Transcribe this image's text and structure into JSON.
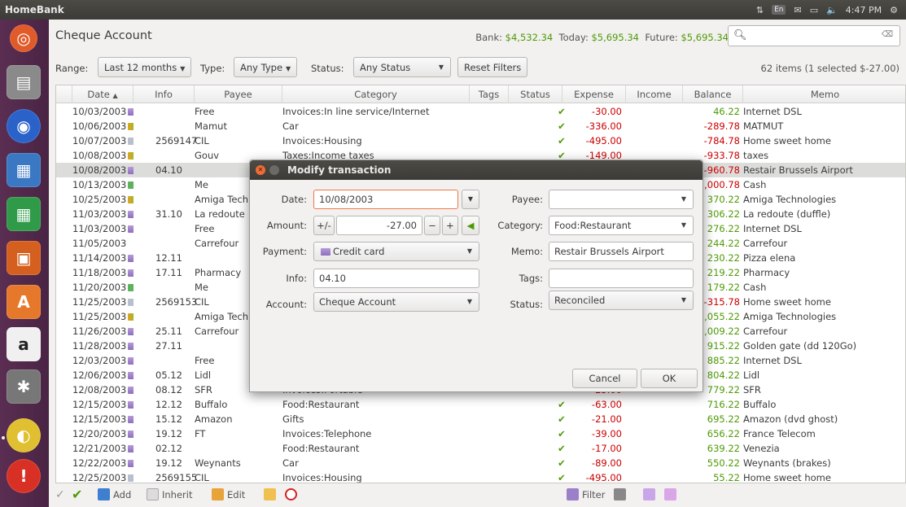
{
  "app_title": "HomeBank",
  "indicators": {
    "keyboard": "En",
    "time": "4:47 PM"
  },
  "account": {
    "title": "Cheque Account",
    "bank_label": "Bank:",
    "bank_value": "$4,532.34",
    "today_label": "Today:",
    "today_value": "$5,695.34",
    "future_label": "Future:",
    "future_value": "$5,695.34"
  },
  "filters": {
    "range_label": "Range:",
    "range_value": "Last 12 months",
    "type_label": "Type:",
    "type_value": "Any Type",
    "status_label": "Status:",
    "status_value": "Any Status",
    "reset_label": "Reset Filters",
    "items_count": "62 items (1 selected $-27.00)"
  },
  "columns": [
    "Date",
    "Info",
    "Payee",
    "Category",
    "Tags",
    "Status",
    "Expense",
    "Income",
    "Balance",
    "Memo"
  ],
  "rows": [
    {
      "date": "10/03/2003",
      "pay": "card",
      "info": "",
      "payee": "Free",
      "cat": "Invoices:In line service/Internet",
      "exp": "-30.00",
      "bal": "46.22",
      "memo": "Internet DSL"
    },
    {
      "date": "10/06/2003",
      "pay": "xfer",
      "info": "",
      "payee": "Mamut",
      "cat": "Car",
      "exp": "-336.00",
      "bal": "-289.78",
      "memo": "MATMUT"
    },
    {
      "date": "10/07/2003",
      "pay": "check",
      "info": "2569147",
      "payee": "CIL",
      "cat": "Invoices:Housing",
      "exp": "-495.00",
      "bal": "-784.78",
      "memo": "Home sweet home"
    },
    {
      "date": "10/08/2003",
      "pay": "xfer",
      "info": "",
      "payee": "Gouv",
      "cat": "Taxes:Income taxes",
      "exp": "-149.00",
      "bal": "-933.78",
      "memo": "taxes"
    },
    {
      "date": "10/08/2003",
      "pay": "card",
      "info": "04.10",
      "payee": "",
      "cat": "",
      "exp": "",
      "bal": "-960.78",
      "memo": "Restair Brussels Airport",
      "sel": true
    },
    {
      "date": "10/13/2003",
      "pay": "cash",
      "info": "",
      "payee": "Me",
      "cat": "",
      "exp": "",
      "bal": "-1,000.78",
      "memo": "Cash"
    },
    {
      "date": "10/25/2003",
      "pay": "xfer",
      "info": "",
      "payee": "Amiga Tech",
      "cat": "",
      "exp": "",
      "bal": "370.22",
      "memo": "Amiga Technologies"
    },
    {
      "date": "11/03/2003",
      "pay": "card",
      "info": "31.10",
      "payee": "La redoute",
      "cat": "",
      "exp": "",
      "bal": "306.22",
      "memo": "La redoute (duffle)"
    },
    {
      "date": "11/03/2003",
      "pay": "card",
      "info": "",
      "payee": "Free",
      "cat": "",
      "exp": "",
      "bal": "276.22",
      "memo": "Internet DSL"
    },
    {
      "date": "11/05/2003",
      "pay": "none",
      "info": "",
      "payee": "Carrefour",
      "cat": "",
      "exp": "",
      "bal": "244.22",
      "memo": "Carrefour"
    },
    {
      "date": "11/14/2003",
      "pay": "card",
      "info": "12.11",
      "payee": "",
      "cat": "",
      "exp": "",
      "bal": "230.22",
      "memo": "Pizza elena"
    },
    {
      "date": "11/18/2003",
      "pay": "card",
      "info": "17.11",
      "payee": "Pharmacy",
      "cat": "",
      "exp": "",
      "bal": "219.22",
      "memo": "Pharmacy"
    },
    {
      "date": "11/20/2003",
      "pay": "cash",
      "info": "",
      "payee": "Me",
      "cat": "",
      "exp": "",
      "bal": "179.22",
      "memo": "Cash"
    },
    {
      "date": "11/25/2003",
      "pay": "check",
      "info": "2569153",
      "payee": "CIL",
      "cat": "",
      "exp": "",
      "bal": "-315.78",
      "memo": "Home sweet home"
    },
    {
      "date": "11/25/2003",
      "pay": "xfer",
      "info": "",
      "payee": "Amiga Tech",
      "cat": "",
      "exp": "",
      "bal": "1,055.22",
      "memo": "Amiga Technologies"
    },
    {
      "date": "11/26/2003",
      "pay": "card",
      "info": "25.11",
      "payee": "Carrefour",
      "cat": "",
      "exp": "",
      "bal": "1,009.22",
      "memo": "Carrefour"
    },
    {
      "date": "11/28/2003",
      "pay": "card",
      "info": "27.11",
      "payee": "",
      "cat": "",
      "exp": "",
      "bal": "915.22",
      "memo": "Golden gate (dd 120Go)"
    },
    {
      "date": "12/03/2003",
      "pay": "card",
      "info": "",
      "payee": "Free",
      "cat": "",
      "exp": "",
      "bal": "885.22",
      "memo": "Internet DSL"
    },
    {
      "date": "12/06/2003",
      "pay": "card",
      "info": "05.12",
      "payee": "Lidl",
      "cat": "",
      "exp": "",
      "bal": "804.22",
      "memo": "Lidl"
    },
    {
      "date": "12/08/2003",
      "pay": "card",
      "info": "08.12",
      "payee": "SFR",
      "cat": "Invoices:Portable",
      "exp": "-25.00",
      "bal": "779.22",
      "memo": "SFR"
    },
    {
      "date": "12/15/2003",
      "pay": "card",
      "info": "12.12",
      "payee": "Buffalo",
      "cat": "Food:Restaurant",
      "exp": "-63.00",
      "bal": "716.22",
      "memo": "Buffalo"
    },
    {
      "date": "12/15/2003",
      "pay": "card",
      "info": "15.12",
      "payee": "Amazon",
      "cat": "Gifts",
      "exp": "-21.00",
      "bal": "695.22",
      "memo": "Amazon (dvd ghost)"
    },
    {
      "date": "12/20/2003",
      "pay": "card",
      "info": "19.12",
      "payee": "FT",
      "cat": "Invoices:Telephone",
      "exp": "-39.00",
      "bal": "656.22",
      "memo": "France Telecom"
    },
    {
      "date": "12/21/2003",
      "pay": "card",
      "info": "02.12",
      "payee": "",
      "cat": "Food:Restaurant",
      "exp": "-17.00",
      "bal": "639.22",
      "memo": "Venezia"
    },
    {
      "date": "12/22/2003",
      "pay": "card",
      "info": "19.12",
      "payee": "Weynants",
      "cat": "Car",
      "exp": "-89.00",
      "bal": "550.22",
      "memo": "Weynants (brakes)"
    },
    {
      "date": "12/25/2003",
      "pay": "check",
      "info": "2569155",
      "payee": "CIL",
      "cat": "Invoices:Housing",
      "exp": "-495.00",
      "bal": "55.22",
      "memo": "Home sweet home"
    }
  ],
  "toolbar": {
    "add": "Add",
    "inherit": "Inherit",
    "edit": "Edit",
    "filter": "Filter"
  },
  "dialog": {
    "title": "Modify transaction",
    "date_label": "Date:",
    "date_value": "10/08/2003",
    "amount_label": "Amount:",
    "amount_sign": "+/-",
    "amount_value": "-27.00",
    "minus": "−",
    "plus": "+",
    "payment_label": "Payment:",
    "payment_value": "Credit card",
    "info_label": "Info:",
    "info_value": "04.10",
    "account_label": "Account:",
    "account_value": "Cheque Account",
    "payee_label": "Payee:",
    "payee_value": "",
    "category_label": "Category:",
    "category_value": "Food:Restaurant",
    "memo_label": "Memo:",
    "memo_value": "Restair Brussels Airport",
    "tags_label": "Tags:",
    "tags_value": "",
    "status_label": "Status:",
    "status_value": "Reconciled",
    "cancel": "Cancel",
    "ok": "OK"
  },
  "colors": {
    "positive": "#4e9a06",
    "negative": "#cc0000",
    "accent": "#f07746"
  }
}
